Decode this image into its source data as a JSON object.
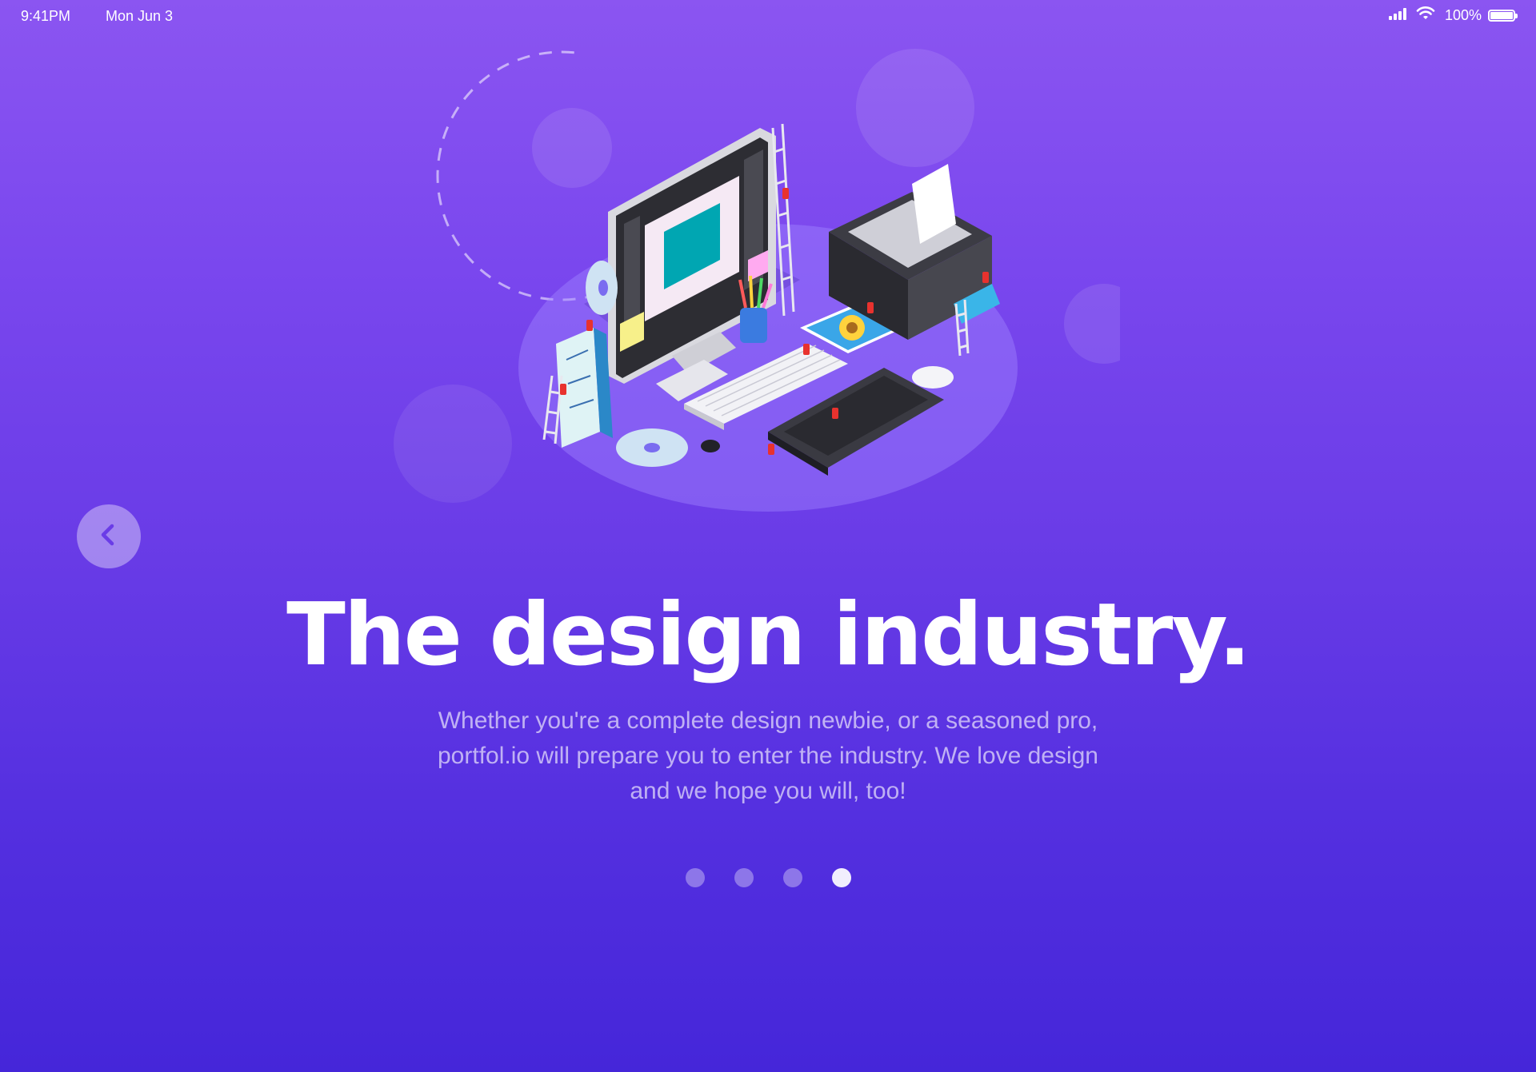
{
  "status_bar": {
    "time": "9:41PM",
    "date": "Mon Jun 3",
    "battery_percent": "100%",
    "battery_level": 1.0,
    "icons": [
      "cellular-signal-icon",
      "wifi-icon",
      "battery-icon"
    ]
  },
  "hero": {
    "illustration": "isometric-design-workspace-illustration"
  },
  "navigation": {
    "back_icon": "chevron-left-icon"
  },
  "content": {
    "headline": "The design industry.",
    "body_lines": [
      "Whether you're a complete design newbie, or a seasoned pro,",
      "portfol.io will prepare you to enter the industry. We love design",
      "and we hope you will, too!"
    ]
  },
  "pager": {
    "total": 4,
    "active_index": 3
  },
  "colors": {
    "background_top": "#8b55f1",
    "background_bottom": "#4526d9",
    "accent": "#6a3ce7"
  }
}
